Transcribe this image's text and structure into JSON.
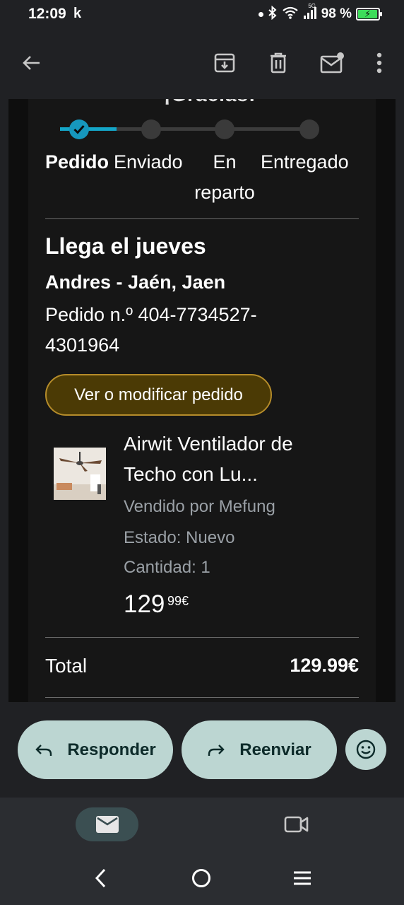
{
  "status_bar": {
    "time": "12:09",
    "carrier_glyph": "k",
    "network_label": "5G",
    "battery_percent": "98 %",
    "battery_level": 0.98,
    "icons": [
      "dot-icon",
      "bluetooth-icon",
      "wifi-icon",
      "signal-icon",
      "battery-charging-icon"
    ]
  },
  "app_bar": {
    "icons": [
      "back-arrow-icon",
      "archive-icon",
      "delete-icon",
      "mark-unread-icon",
      "more-vert-icon"
    ]
  },
  "email": {
    "cut_off_heading": "¡Gracias!",
    "progress": {
      "steps": [
        {
          "label": "Pedido",
          "state": "done"
        },
        {
          "label": "Enviado",
          "state": "pending"
        },
        {
          "label": "En reparto",
          "state": "pending"
        },
        {
          "label": "Entregado",
          "state": "pending"
        }
      ],
      "accent_color": "#14a6c8"
    },
    "arrival_text": "Llega el jueves",
    "address": "Andres - Jaén, Jaen",
    "order_number": "Pedido n.º 404-7734527-4301964",
    "view_order_label": "Ver o modificar pedido",
    "product": {
      "title": "Airwit Ventilador de Techo con Lu...",
      "seller": "Vendido por Mefung",
      "condition": "Estado: Nuevo",
      "quantity": "Cantidad: 1",
      "price_main": "129",
      "price_fraction": "99€"
    },
    "total_label": "Total",
    "total_value": "129.99€"
  },
  "actions": {
    "reply_label": "Responder",
    "forward_label": "Reenviar",
    "button_color": "#bcd6d2"
  },
  "bottom_nav": {
    "items": [
      {
        "icon": "mail-icon",
        "selected": true
      },
      {
        "icon": "video-icon",
        "selected": false
      }
    ]
  },
  "system_nav": {
    "icons": [
      "back-icon",
      "home-icon",
      "recents-icon"
    ]
  }
}
